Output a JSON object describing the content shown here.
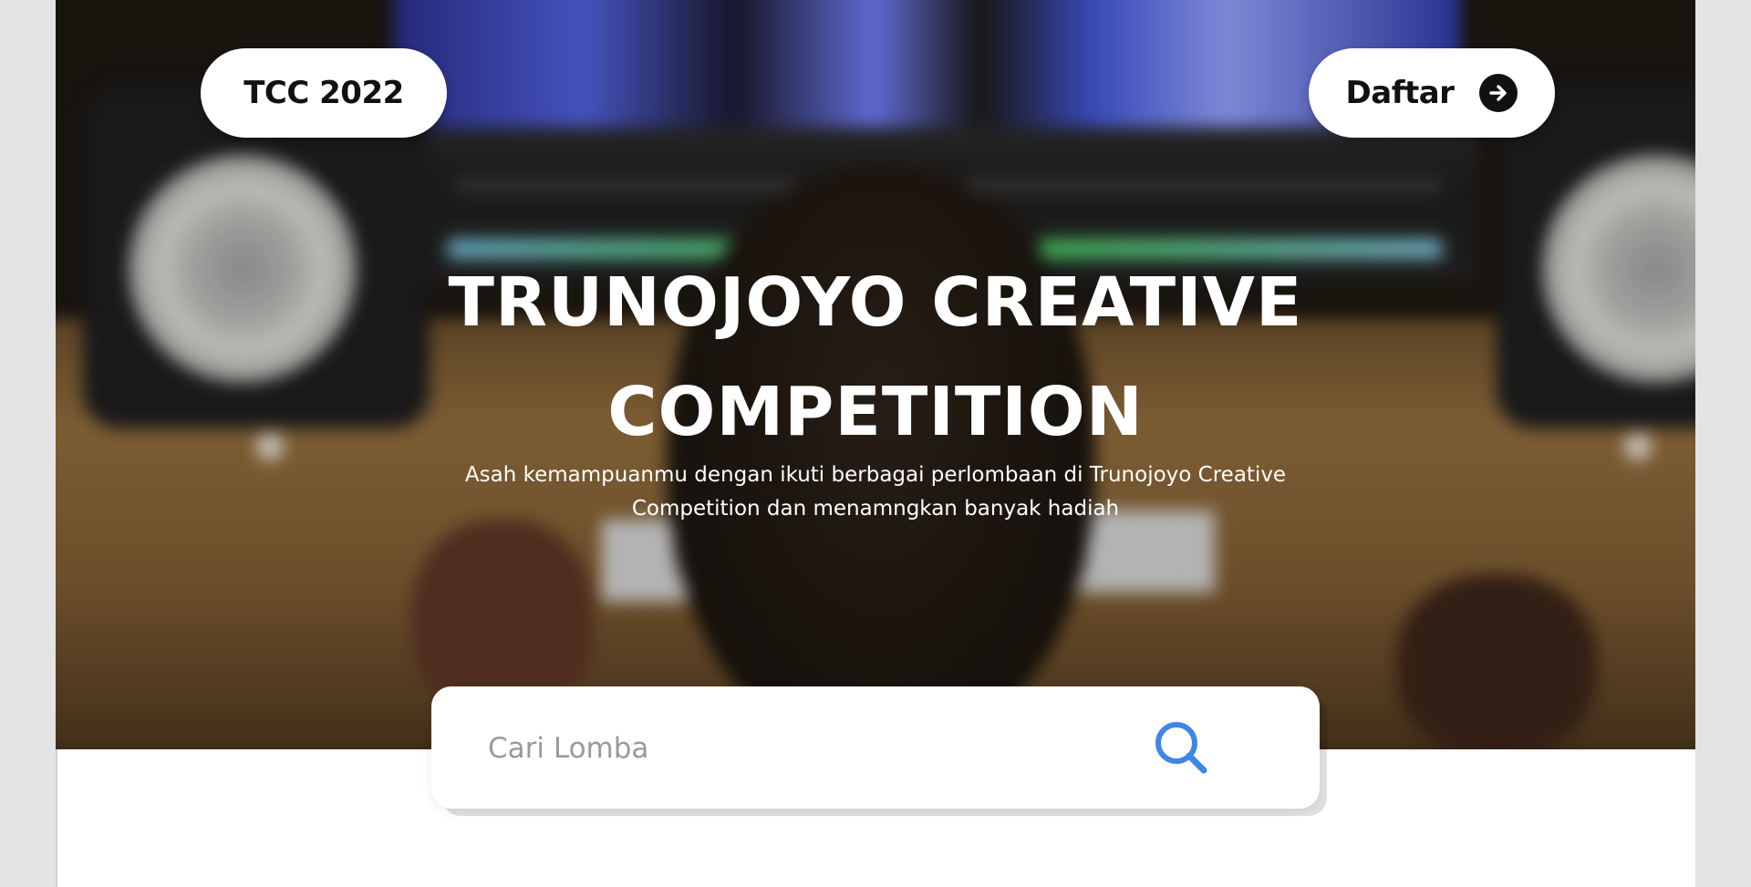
{
  "brand": {
    "label": "TCC 2022"
  },
  "nav": {
    "register_label": "Daftar",
    "register_icon": "arrow-right-circle-icon"
  },
  "hero": {
    "title_line1": "TRUNOJOYO CREATIVE",
    "title_line2": "COMPETITION",
    "subtitle_line1": "Asah kemampuanmu dengan ikuti berbagai perlombaan di Trunojoyo Creative",
    "subtitle_line2": "Competition dan menamngkan banyak hadiah"
  },
  "search": {
    "placeholder": "Cari Lomba",
    "icon": "search-icon"
  },
  "colors": {
    "accent": "#3d87e6",
    "pill_background": "#ffffff",
    "text_dark": "#111111",
    "page_background": "#e4e4e4"
  }
}
